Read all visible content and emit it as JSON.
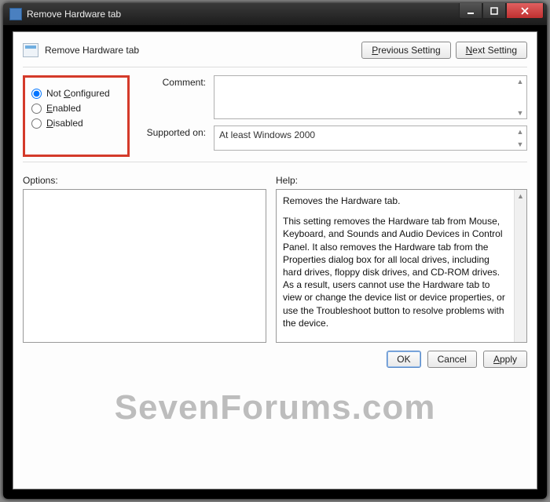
{
  "window": {
    "title": "Remove Hardware tab"
  },
  "header": {
    "policy_name": "Remove Hardware tab",
    "prev_label": "Previous Setting",
    "next_label": "Next Setting"
  },
  "state": {
    "options": [
      {
        "label": "Not Configured",
        "u": "C",
        "checked": true
      },
      {
        "label": "Enabled",
        "u": "E",
        "checked": false
      },
      {
        "label": "Disabled",
        "u": "D",
        "checked": false
      }
    ]
  },
  "fields": {
    "comment_label": "Comment:",
    "comment_value": "",
    "supported_label": "Supported on:",
    "supported_value": "At least Windows 2000"
  },
  "panels": {
    "options_label": "Options:",
    "help_label": "Help:",
    "help_body": {
      "p1": "Removes the Hardware tab.",
      "p2": "This setting removes the Hardware tab from Mouse, Keyboard, and Sounds and Audio Devices in Control Panel. It also removes the Hardware tab from the Properties dialog box for all local drives, including hard drives, floppy disk drives, and CD-ROM drives. As a result, users cannot use the Hardware tab to view or change the device list or device properties, or use the Troubleshoot button to resolve problems with the device."
    }
  },
  "buttons": {
    "ok": "OK",
    "cancel": "Cancel",
    "apply": "Apply"
  },
  "watermark": "SevenForums.com"
}
